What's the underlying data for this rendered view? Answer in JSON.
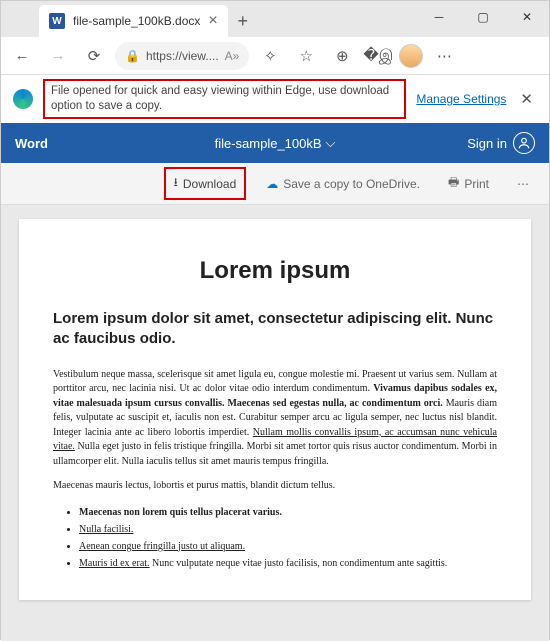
{
  "tab": {
    "title": "file-sample_100kB.docx"
  },
  "address": {
    "url": "https://view...."
  },
  "infobar": {
    "text": "File opened for quick and easy viewing within Edge, use download option to save a copy.",
    "manage": "Manage Settings"
  },
  "word": {
    "app": "Word",
    "doc": "file-sample_100kB",
    "signin": "Sign in"
  },
  "toolbar": {
    "download": "Download",
    "onedrive": "Save a copy to OneDrive.",
    "print": "Print"
  },
  "document": {
    "title": "Lorem ipsum",
    "subtitle": "Lorem ipsum dolor sit amet, consectetur adipiscing elit. Nunc ac faucibus odio.",
    "p1_a": "Vestibulum neque massa, scelerisque sit amet ligula eu, congue molestie mi. Praesent ut varius sem. Nullam at porttitor arcu, nec lacinia nisi. Ut ac dolor vitae odio interdum condimentum. ",
    "p1_b": "Vivamus dapibus sodales ex, vitae malesuada ipsum cursus convallis. Maecenas sed egestas nulla, ac condimentum orci.",
    "p1_c": " Mauris diam felis, vulputate ac suscipit et, iaculis non est. Curabitur semper arcu ac ligula semper, nec luctus nisl blandit. Integer lacinia ante ac libero lobortis imperdiet. ",
    "p1_d": "Nullam mollis convallis ipsum, ac accumsan nunc vehicula vitae.",
    "p1_e": " Nulla eget justo in felis tristique fringilla. Morbi sit amet tortor quis risus auctor condimentum. Morbi in ullamcorper elit. Nulla iaculis tellus sit amet mauris tempus fringilla.",
    "p2": "Maecenas mauris lectus, lobortis et purus mattis, blandit dictum tellus.",
    "li1": "Maecenas non lorem quis tellus placerat varius.",
    "li2": "Nulla facilisi.",
    "li3": "Aenean congue fringilla justo ut aliquam.",
    "li4_a": "Mauris id ex erat.",
    "li4_b": " Nunc vulputate neque vitae justo facilisis, non condimentum ante sagittis."
  }
}
